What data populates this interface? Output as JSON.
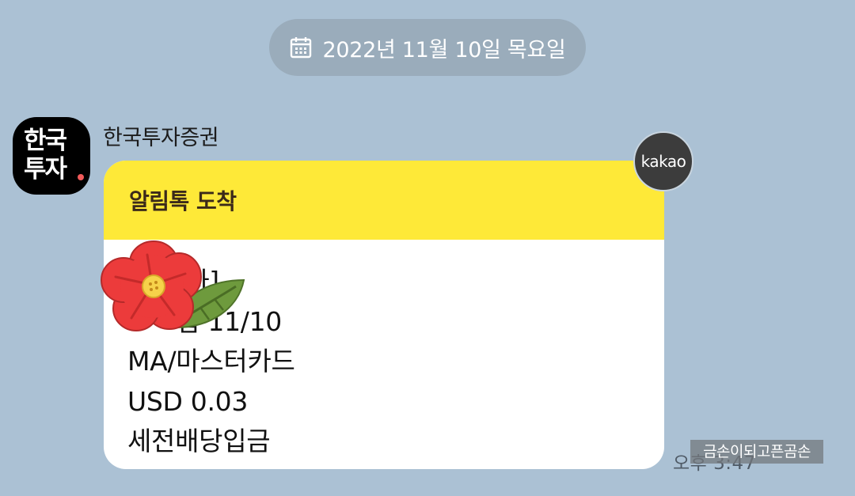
{
  "date_divider": {
    "icon": "calendar-icon",
    "text": "2022년 11월 10일 목요일"
  },
  "sender": {
    "avatar_lines": [
      "한국",
      "투자"
    ],
    "avatar_dot_color": "#f05a5a",
    "name": "한국투자증권"
  },
  "message": {
    "header_color": "#fee938",
    "header_title": "알림톡 도착",
    "lines": [
      "[   투자]",
      "      입 11/10",
      "MA/마스터카드",
      "USD 0.03",
      "세전배당입금"
    ],
    "badge": "kakao",
    "time": "오후 3:47"
  },
  "sticker": {
    "icon": "flower-sticker-icon"
  },
  "watermark": {
    "text": "금손이되고픈곰손"
  }
}
